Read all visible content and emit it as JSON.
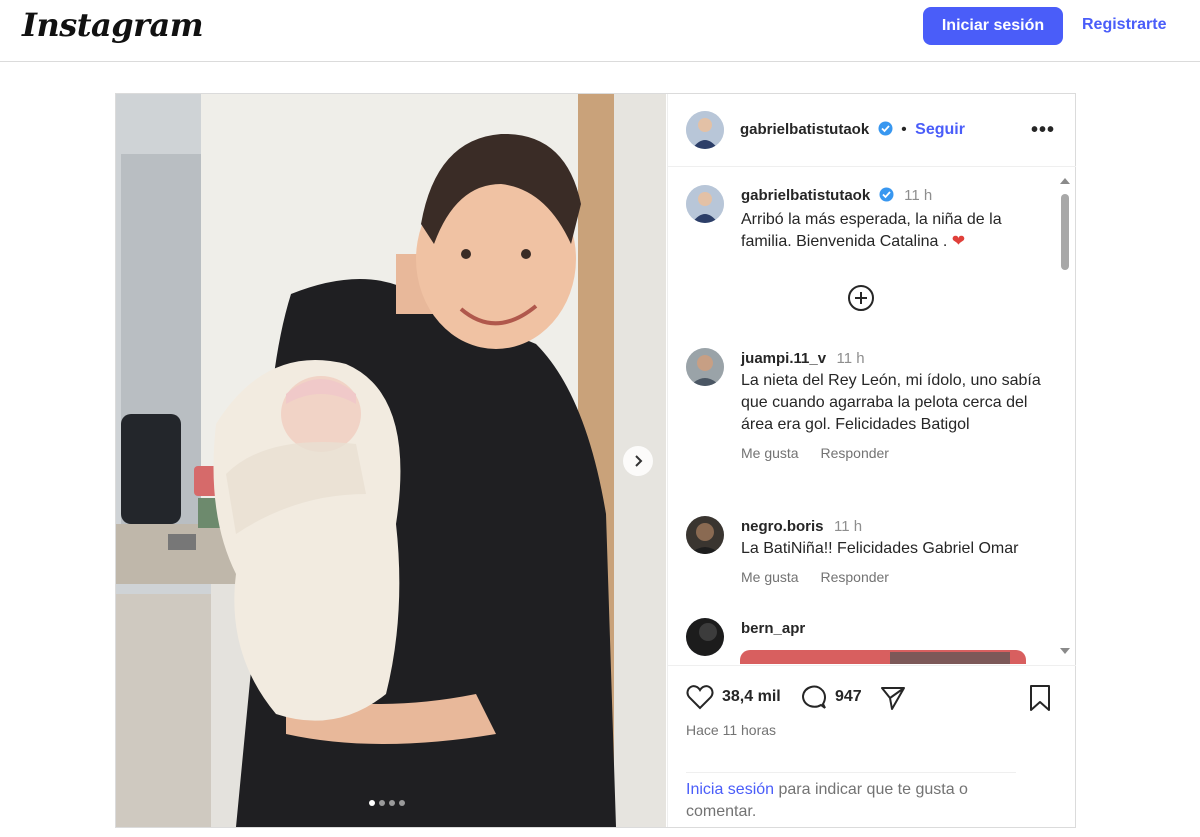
{
  "header": {
    "logo": "Instagram",
    "login_label": "Iniciar sesión",
    "signup_label": "Registrarte"
  },
  "post": {
    "author": {
      "username": "gabrielbatistutaok",
      "verified": true,
      "follow_separator": "•",
      "follow_label": "Seguir"
    },
    "more_icon": "more-horizontal-icon",
    "caption": {
      "username": "gabrielbatistutaok",
      "time": "11 h",
      "text": "Arribó la más esperada, la niña de la familia. Bienvenida Catalina .",
      "emoji": "❤"
    },
    "load_more_icon": "plus-circle-icon",
    "comments": [
      {
        "username": "juampi.11_v",
        "time": "11 h",
        "text": "La nieta del Rey León, mi ídolo, uno sabía que cuando agarraba la pelota cerca del área era gol. Felicidades Batigol",
        "like_label": "Me gusta",
        "reply_label": "Responder"
      },
      {
        "username": "negro.boris",
        "time": "11 h",
        "text": "La BatiNiña!! Felicidades Gabriel Omar",
        "like_label": "Me gusta",
        "reply_label": "Responder"
      },
      {
        "username": "bern_apr"
      }
    ],
    "likes": "38,4 mil",
    "comment_count": "947",
    "posted_ago": "Hace 11 horas",
    "login_prompt": {
      "link": "Inicia sesión",
      "rest": " para indicar que te gusta o comentar."
    },
    "carousel": {
      "total": 4,
      "current": 1
    }
  },
  "colors": {
    "accent": "#4a5df9",
    "heart": "#e0403a",
    "verified": "#3897f0"
  }
}
